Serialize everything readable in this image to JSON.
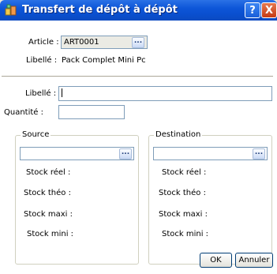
{
  "window": {
    "title": "Transfert de dépôt à dépôt",
    "help_label": "?",
    "close_label": "X"
  },
  "article": {
    "label": "Article :",
    "value": "ART0001",
    "libelle_label": "Libellé :",
    "libelle_value": "Pack Complet Mini Pc"
  },
  "form": {
    "libelle_label": "Libellé :",
    "libelle_value": "",
    "quantite_label": "Quantité :",
    "quantite_value": ""
  },
  "source": {
    "title": "Source",
    "value": "",
    "stock_reel_label": "Stock réel :",
    "stock_theo_label": "Stock théo :",
    "stock_maxi_label": "Stock maxi :",
    "stock_mini_label": "Stock mini :"
  },
  "destination": {
    "title": "Destination",
    "value": "",
    "stock_reel_label": "Stock réel :",
    "stock_theo_label": "Stock théo :",
    "stock_maxi_label": "Stock maxi :",
    "stock_mini_label": "Stock mini :"
  },
  "buttons": {
    "ok_label": "OK",
    "cancel_label": "Annuler",
    "browse_label": "..."
  },
  "colors": {
    "titlebar": "#0a4fcf",
    "dialog_bg": "#ffffff",
    "field_border": "#7f9db9"
  }
}
